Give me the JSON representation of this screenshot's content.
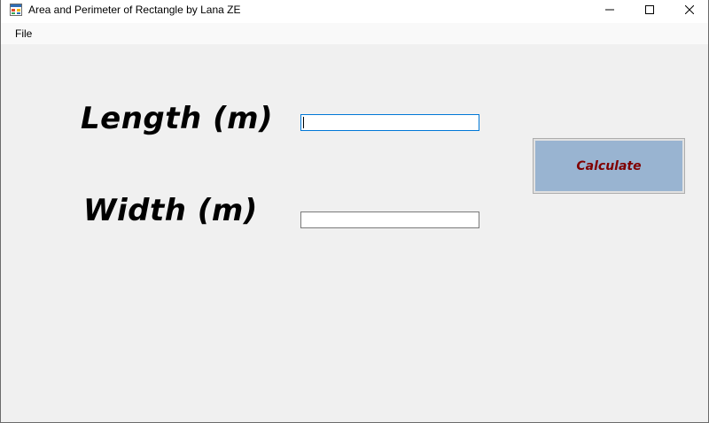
{
  "window": {
    "title": "Area and Perimeter of Rectangle by Lana ZE",
    "controls": {
      "minimize": "minimize",
      "maximize": "maximize",
      "close": "close"
    }
  },
  "menu": {
    "items": [
      "File"
    ]
  },
  "form": {
    "length_label": "Length (m)",
    "width_label": "Width (m)",
    "length_value": "",
    "width_value": "",
    "calculate_label": "Calculate"
  },
  "colors": {
    "form_bg": "#f0f0f0",
    "button_fill": "#99b4d1",
    "button_text": "#800000",
    "focus_border": "#0078d7"
  },
  "icons": {
    "app": "app-form-icon",
    "minimize": "minimize-icon",
    "maximize": "maximize-icon",
    "close": "close-icon"
  }
}
